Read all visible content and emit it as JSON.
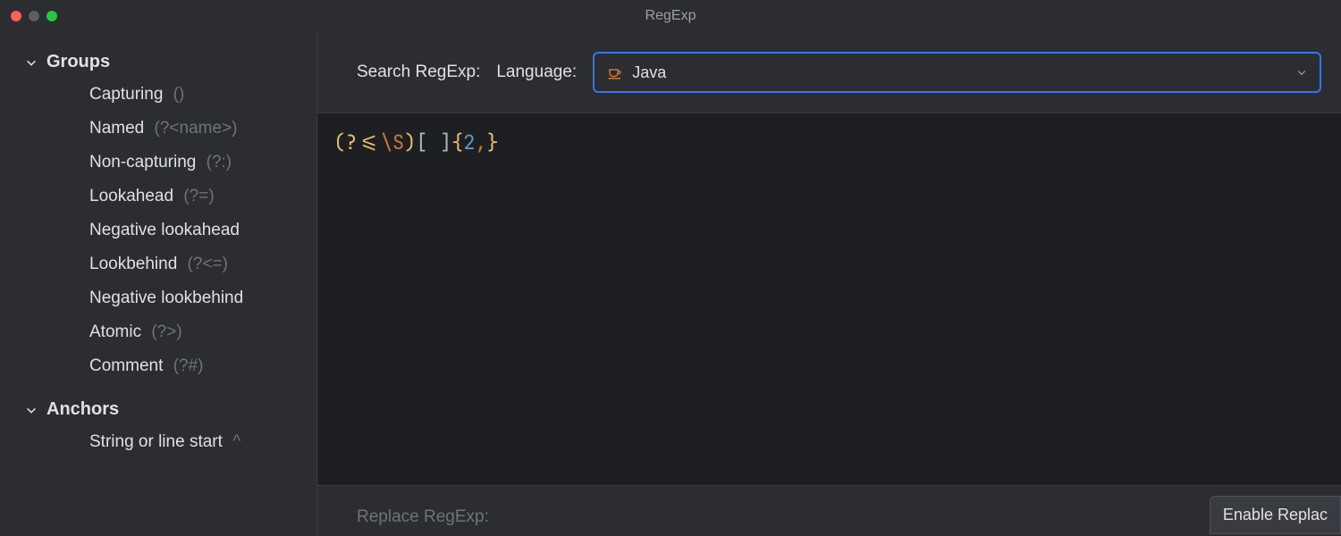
{
  "window": {
    "title": "RegExp"
  },
  "sidebar": {
    "groups": [
      {
        "label": "Groups",
        "items": [
          {
            "label": "Capturing",
            "hint": "()"
          },
          {
            "label": "Named",
            "hint": "(?<name>)"
          },
          {
            "label": "Non-capturing",
            "hint": "(?:)"
          },
          {
            "label": "Lookahead",
            "hint": "(?=)"
          },
          {
            "label": "Negative lookahead",
            "hint": ""
          },
          {
            "label": "Lookbehind",
            "hint": "(?<=)"
          },
          {
            "label": "Negative lookbehind",
            "hint": ""
          },
          {
            "label": "Atomic",
            "hint": "(?>)"
          },
          {
            "label": "Comment",
            "hint": "(?#)"
          }
        ]
      },
      {
        "label": "Anchors",
        "items": [
          {
            "label": "String or line start",
            "hint": "^"
          }
        ]
      }
    ]
  },
  "header": {
    "search_label": "Search RegExp:",
    "language_label": "Language:",
    "language_value": "Java"
  },
  "editor": {
    "regex_tokens": [
      {
        "text": "(?<=",
        "cls": "tok-yellow"
      },
      {
        "text": "\\S",
        "cls": "tok-orange"
      },
      {
        "text": ")",
        "cls": "tok-yellow"
      },
      {
        "text": "[ ]",
        "cls": "tok-gray"
      },
      {
        "text": "{",
        "cls": "tok-yellow"
      },
      {
        "text": "2",
        "cls": "tok-blue"
      },
      {
        "text": ",",
        "cls": "tok-orange"
      },
      {
        "text": "}",
        "cls": "tok-yellow"
      }
    ]
  },
  "footer": {
    "replace_label": "Replace RegExp:",
    "enable_button": "Enable Replac"
  }
}
